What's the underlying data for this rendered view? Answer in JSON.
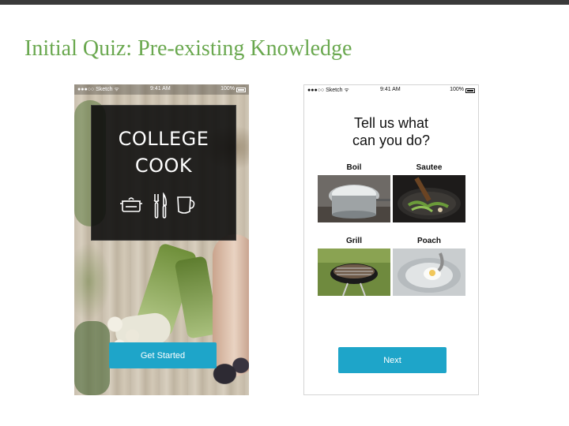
{
  "slide": {
    "title": "Initial Quiz: Pre-existing Knowledge",
    "title_color": "#6aa84f"
  },
  "splash": {
    "status": {
      "carrier": "●●●○○ Sketch ᯤ",
      "time": "9:41 AM",
      "battery": "100%"
    },
    "logo_line1": "COLLEGE",
    "logo_line2": "COOK",
    "logo_icons": [
      "pot-icon",
      "fork-knife-icon",
      "mug-icon"
    ],
    "cta_label": "Get Started",
    "accent": "#1ea5c9"
  },
  "quiz": {
    "status": {
      "carrier": "●●●○○ Sketch ᯤ",
      "time": "9:41 AM",
      "battery": "100%"
    },
    "heading_line1": "Tell us what",
    "heading_line2": "can you do?",
    "options": [
      {
        "label": "Boil",
        "image": "boiling-pot-photo"
      },
      {
        "label": "Sautee",
        "image": "sauteing-pan-photo"
      },
      {
        "label": "Grill",
        "image": "charcoal-grill-photo"
      },
      {
        "label": "Poach",
        "image": "poached-egg-photo"
      }
    ],
    "next_label": "Next",
    "accent": "#1ea5c9"
  }
}
